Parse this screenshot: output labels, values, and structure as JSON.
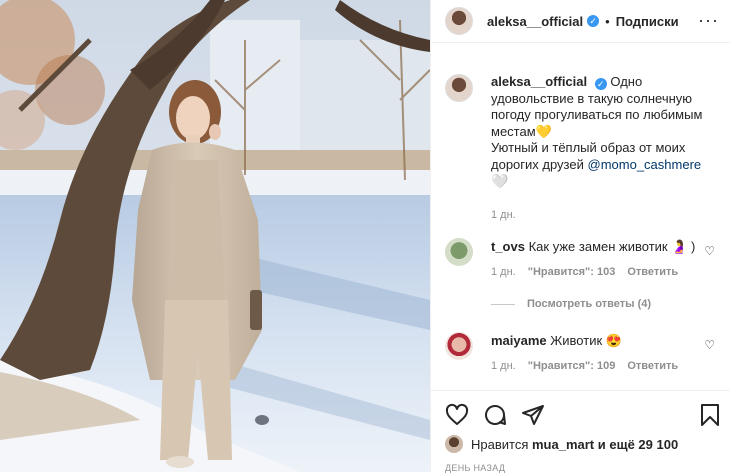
{
  "post": {
    "username": "aleksa__official",
    "verified_icon": "verified-badge-icon",
    "separator": "•",
    "follow_label": "Подписки",
    "more_label": "···"
  },
  "caption": {
    "username": "aleksa__official",
    "text_1": "Одно удовольствие в такую солнечную погоду прогуливаться по любимым местам",
    "heart_yellow": "💛",
    "text_2": "Уютный и тёплый образ от моих дорогих друзей",
    "mention": "@momo_cashmere",
    "heart_white": "🤍",
    "age": "1 дн."
  },
  "comments": [
    {
      "username": "t_ovs",
      "text": "Как уже замен животик",
      "emoji": "🤰",
      "suffix": ")",
      "age": "1 дн.",
      "likes": "\"Нравится\": 103",
      "reply": "Ответить"
    },
    {
      "username": "maiyame",
      "text": "Животик",
      "emoji": "😍",
      "suffix": "",
      "age": "1 дн.",
      "likes": "\"Нравится\": 109",
      "reply": "Ответить"
    }
  ],
  "view_replies": "Посмотреть ответы (4)",
  "actions": {
    "like_icon": "heart-outline-icon",
    "comment_icon": "comment-bubble-icon",
    "share_icon": "paper-plane-icon",
    "save_icon": "bookmark-icon"
  },
  "likes_line": {
    "prefix": "Нравится",
    "user": "mua_mart",
    "suffix": "и ещё 29 100"
  },
  "timestamp": "ДЕНЬ НАЗАД",
  "colors": {
    "link": "#00376b",
    "verified": "#3897f0",
    "muted": "#8e8e8e",
    "heart_red": "#ed4956"
  }
}
